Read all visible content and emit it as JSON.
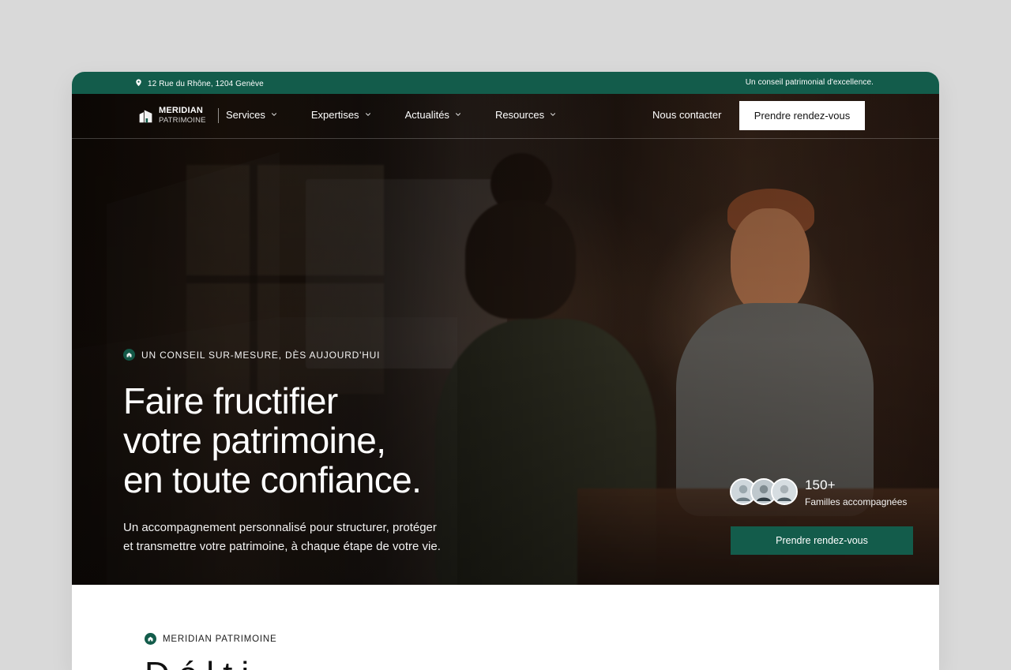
{
  "colors": {
    "accent": "#135c4b",
    "page_bg": "#d9d9d9",
    "white": "#ffffff"
  },
  "topbar": {
    "address": "12 Rue du Rhône, 1204 Genève",
    "tagline": "Un conseil patrimonial d'excellence.",
    "icon": "location-pin-icon"
  },
  "brand": {
    "line1": "MERIDIAN",
    "line2": "PATRIMOINE",
    "icon": "building-logo-icon"
  },
  "nav": {
    "items": [
      {
        "label": "Services"
      },
      {
        "label": "Expertises"
      },
      {
        "label": "Actualités"
      },
      {
        "label": "Resources"
      }
    ],
    "contact_label": "Nous contacter",
    "cta_label": "Prendre rendez-vous",
    "chevron_icon": "chevron-down-icon"
  },
  "hero": {
    "eyebrow": "UN CONSEIL SUR-MESURE, DÈS AUJOURD'HUI",
    "headline_lines": [
      "Faire fructifier",
      "votre patrimoine,",
      "en toute confiance."
    ],
    "subtext_lines": [
      "Un accompagnement personnalisé pour structurer, protéger",
      "et transmettre votre patrimoine, à chaque étape de votre vie."
    ],
    "background_image_semantic": "consultation-meeting-photo"
  },
  "stats": {
    "value": "150+",
    "label": "Familles accompagnées",
    "cta_label": "Prendre rendez-vous",
    "avatars": [
      {
        "icon": "avatar-icon"
      },
      {
        "icon": "avatar-icon"
      },
      {
        "icon": "avatar-icon"
      }
    ]
  },
  "below": {
    "eyebrow": "MERIDIAN PATRIMOINE",
    "heading_partial": "D é l t i"
  }
}
